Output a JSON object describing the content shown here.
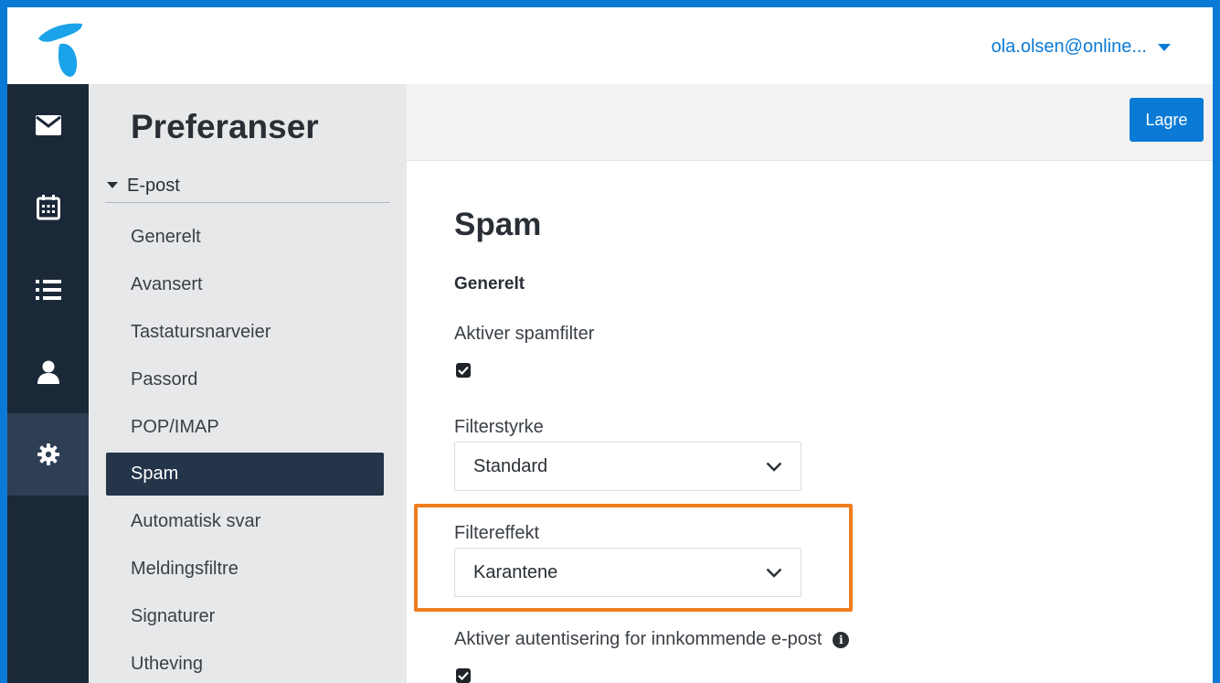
{
  "colors": {
    "brand": "#0a7ad6",
    "rail": "#1b2838",
    "highlight": "#ef7d1f"
  },
  "header": {
    "user": "ola.olsen@online...",
    "user_menu_icon": "caret-down-icon",
    "logo_icon": "telenor-logo"
  },
  "rail": {
    "items": [
      {
        "name": "mail",
        "icon": "envelope-icon",
        "active": false
      },
      {
        "name": "calendar",
        "icon": "calendar-icon",
        "active": false
      },
      {
        "name": "tasks",
        "icon": "list-icon",
        "active": false
      },
      {
        "name": "contacts",
        "icon": "user-icon",
        "active": false
      },
      {
        "name": "settings",
        "icon": "gear-icon",
        "active": true
      }
    ]
  },
  "prefs": {
    "title": "Preferanser",
    "group": "E-post",
    "items": [
      "Generelt",
      "Avansert",
      "Tastatursnarveier",
      "Passord",
      "POP/IMAP",
      "Spam",
      "Automatisk svar",
      "Meldingsfiltre",
      "Signaturer",
      "Utheving"
    ],
    "active_index": 5
  },
  "toolbar": {
    "save_label": "Lagre"
  },
  "main": {
    "title": "Spam",
    "section": "Generelt",
    "enable_spam_label": "Aktiver spamfilter",
    "enable_spam_checked": true,
    "filter_strength_label": "Filterstyrke",
    "filter_strength_value": "Standard",
    "filter_effect_label": "Filtereffekt",
    "filter_effect_value": "Karantene",
    "auth_label": "Aktiver autentisering for innkommende e-post",
    "auth_checked": true
  }
}
